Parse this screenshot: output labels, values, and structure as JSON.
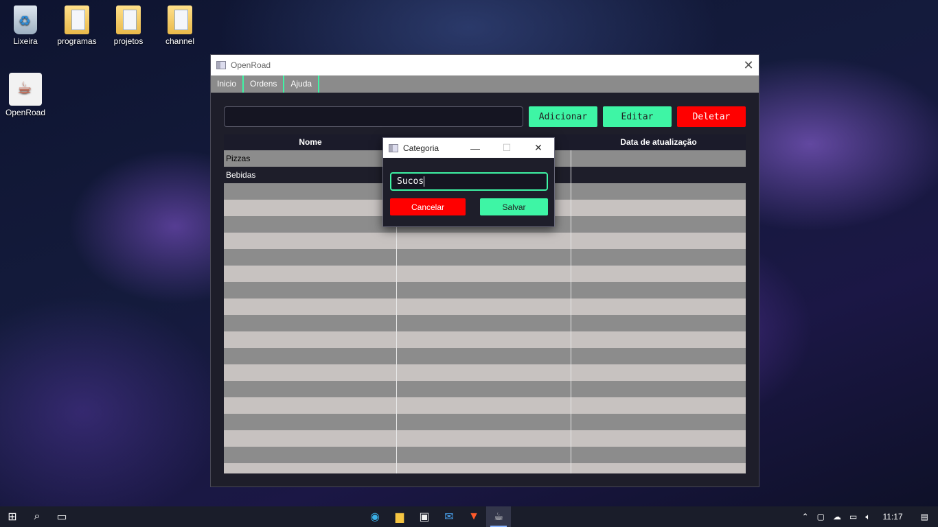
{
  "desktop": {
    "icons": [
      {
        "label": "Lixeira",
        "icon": "recycle-bin-icon"
      },
      {
        "label": "programas",
        "icon": "folder-icon"
      },
      {
        "label": "projetos",
        "icon": "folder-icon"
      },
      {
        "label": "channel",
        "icon": "folder-shortcut-icon"
      },
      {
        "label": "OpenRoad",
        "icon": "java-icon"
      }
    ]
  },
  "main_window": {
    "title": "OpenRoad",
    "menu": [
      "Inicio",
      "Ordens",
      "Ajuda"
    ],
    "search_value": "",
    "buttons": {
      "add": "Adicionar",
      "edit": "Editar",
      "delete": "Deletar"
    },
    "table": {
      "columns": [
        "Nome",
        "",
        "Data de atualização"
      ],
      "rows": [
        {
          "nome": "Pizzas",
          "col2": "",
          "data": ""
        },
        {
          "nome": "Bebidas",
          "col2": "",
          "data": ""
        }
      ]
    }
  },
  "dialog": {
    "title": "Categoria",
    "input_value": "Sucos",
    "cancel": "Cancelar",
    "save": "Salvar"
  },
  "taskbar": {
    "time": "11:17",
    "apps": [
      "start-icon",
      "search-icon",
      "task-view-icon",
      "edge-icon",
      "file-explorer-icon",
      "store-icon",
      "mail-icon",
      "brave-icon",
      "java-icon"
    ]
  },
  "colors": {
    "accent": "#3ef5a5",
    "danger": "#ff0000",
    "window_bg": "#1e1e2a"
  }
}
